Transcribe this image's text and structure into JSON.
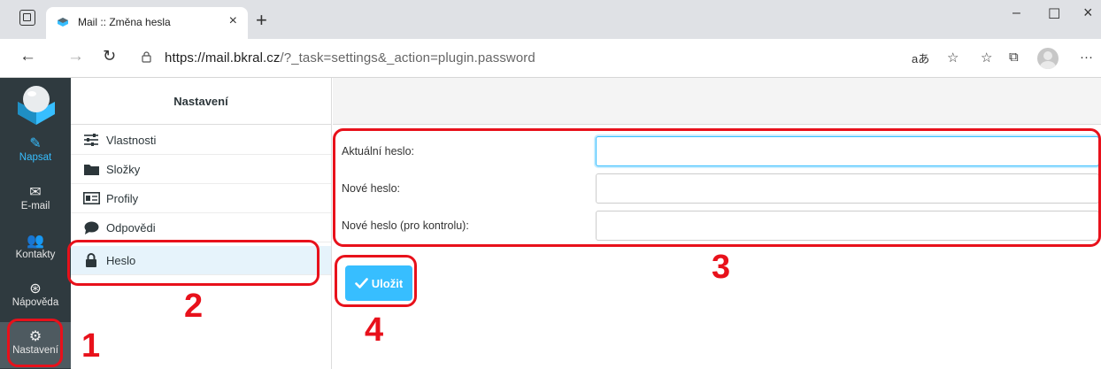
{
  "browser": {
    "tab_title": "Mail :: Změna hesla",
    "tab_close": "×",
    "new_tab": "+",
    "window_controls": {
      "minimize": "–",
      "maximize": "☐",
      "close": "×"
    },
    "url_host": "https://mail.bkral.cz",
    "url_path": "/?_task=settings&_action=plugin.password",
    "toolbar_icons": [
      "read-aloud-icon",
      "add-favorite-icon",
      "favorites-icon",
      "collections-icon",
      "profile-icon",
      "more-icon"
    ]
  },
  "sidebar": {
    "items": [
      {
        "icon": "compose-icon",
        "label": "Napsat"
      },
      {
        "icon": "mail-icon",
        "label": "E-mail"
      },
      {
        "icon": "contacts-icon",
        "label": "Kontakty"
      },
      {
        "icon": "help-icon",
        "label": "Nápověda"
      },
      {
        "icon": "settings-icon",
        "label": "Nastavení"
      }
    ]
  },
  "settings": {
    "title": "Nastavení",
    "items": [
      {
        "icon": "sliders-icon",
        "label": "Vlastnosti"
      },
      {
        "icon": "folder-icon",
        "label": "Složky"
      },
      {
        "icon": "id-card-icon",
        "label": "Profily"
      },
      {
        "icon": "comment-icon",
        "label": "Odpovědi"
      },
      {
        "icon": "lock-icon",
        "label": "Heslo"
      }
    ]
  },
  "form": {
    "current_password_label": "Aktuální heslo:",
    "new_password_label": "Nové heslo:",
    "confirm_password_label": "Nové heslo (pro kontrolu):",
    "save_label": "Uložit"
  },
  "annotations": [
    "1",
    "2",
    "3",
    "4"
  ],
  "colors": {
    "accent": "#37beff",
    "sidebar_bg": "#2f3a3f",
    "annotation": "#e8111b"
  }
}
